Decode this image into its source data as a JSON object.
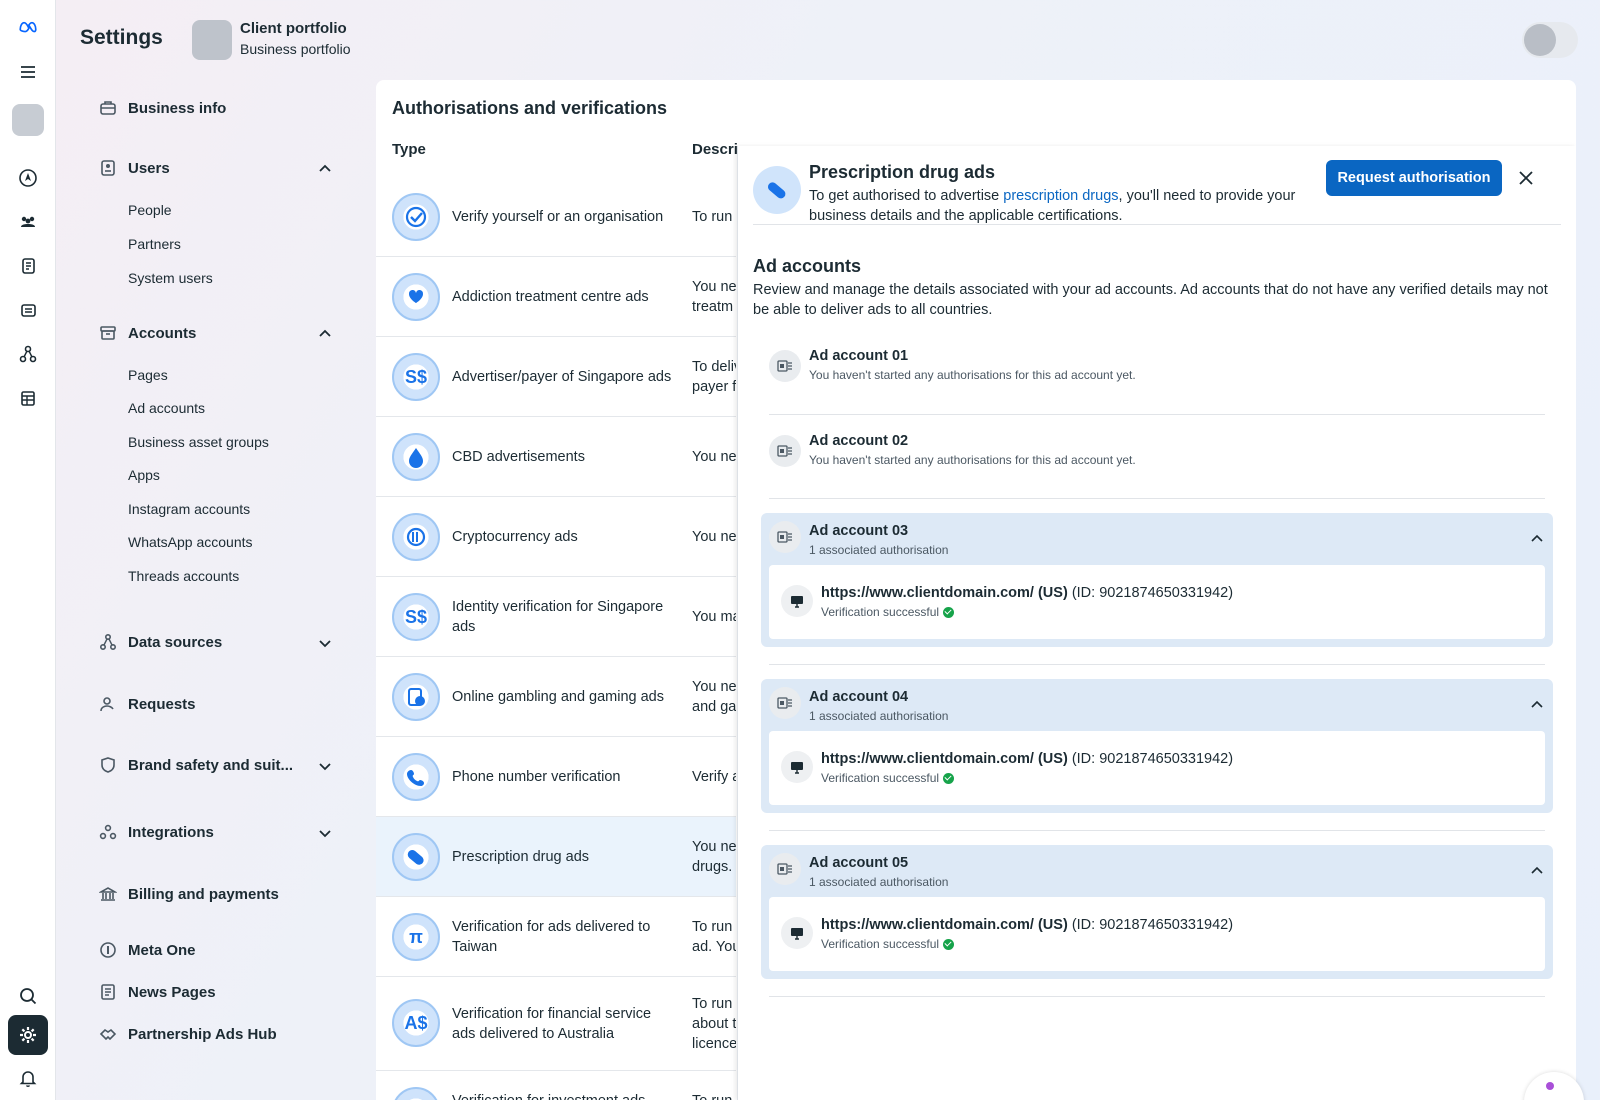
{
  "header": {
    "title": "Settings",
    "portfolio_name": "Client portfolio",
    "portfolio_type": "Business portfolio"
  },
  "rail": {
    "items": [
      "meta-logo-icon",
      "menu-icon",
      "portfolio-square",
      "compass-icon",
      "people-icon",
      "pages-icon",
      "ads-icon",
      "network-icon",
      "table-icon",
      "search-icon",
      "gear-icon",
      "bell-icon"
    ]
  },
  "sidebar": {
    "business_info": "Business info",
    "users": {
      "label": "Users",
      "items": [
        "People",
        "Partners",
        "System users"
      ]
    },
    "accounts": {
      "label": "Accounts",
      "items": [
        "Pages",
        "Ad accounts",
        "Business asset groups",
        "Apps",
        "Instagram accounts",
        "WhatsApp accounts",
        "Threads accounts"
      ]
    },
    "data_sources": "Data sources",
    "requests": "Requests",
    "brand_safety": "Brand safety and suit...",
    "integrations": "Integrations",
    "billing": "Billing and payments",
    "meta_one": "Meta One",
    "news_pages": "News Pages",
    "partnership_ads": "Partnership Ads Hub"
  },
  "main": {
    "title": "Authorisations and verifications",
    "col_type": "Type",
    "col_desc": "Descri",
    "rows": [
      {
        "name": "Verify yourself or an organisation",
        "desc": "To run"
      },
      {
        "name": "Addiction treatment centre ads",
        "desc": "You ne\ntreatm"
      },
      {
        "name": "Advertiser/payer of Singapore ads",
        "desc": "To deliv\npayer f"
      },
      {
        "name": "CBD advertisements",
        "desc": "You ne"
      },
      {
        "name": "Cryptocurrency ads",
        "desc": "You ne"
      },
      {
        "name": "Identity verification for Singapore ads",
        "desc": "You ma"
      },
      {
        "name": "Online gambling and gaming ads",
        "desc": "You ne\nand ga"
      },
      {
        "name": "Phone number verification",
        "desc": "Verify a"
      },
      {
        "name": "Prescription drug ads",
        "desc": "You ne\ndrugs."
      },
      {
        "name": "Verification for ads delivered to Taiwan",
        "desc": "To run\nad. You"
      },
      {
        "name": "Verification for financial service ads delivered to Australia",
        "desc": "To run\nabout t\nlicence"
      },
      {
        "name": "Verification for investment ads",
        "desc": "To run"
      }
    ]
  },
  "panel": {
    "title": "Prescription drug ads",
    "desc_before": "To get authorised to advertise ",
    "desc_link": "prescription drugs",
    "desc_after": ", you'll need to provide your business details and the applicable certifications.",
    "request_button": "Request authorisation",
    "accounts_title": "Ad accounts",
    "accounts_desc": "Review and manage the details associated with your ad accounts. Ad accounts that do not have any verified details may not be able to deliver ads to all countries.",
    "accounts": [
      {
        "name": "Ad account 01",
        "sub": "You haven't started any authorisations for this ad account yet."
      },
      {
        "name": "Ad account 02",
        "sub": "You haven't started any authorisations for this ad account yet."
      },
      {
        "name": "Ad account 03",
        "sub": "1 associated authorisation",
        "url": "https://www.clientdomain.com/ (US)",
        "id": "(ID: 9021874650331942)",
        "status": "Verification successful"
      },
      {
        "name": "Ad account 04",
        "sub": "1 associated authorisation",
        "url": "https://www.clientdomain.com/ (US)",
        "id": "(ID: 9021874650331942)",
        "status": "Verification successful"
      },
      {
        "name": "Ad account 05",
        "sub": "1 associated authorisation",
        "url": "https://www.clientdomain.com/ (US)",
        "id": "(ID: 9021874650331942)",
        "status": "Verification successful"
      }
    ]
  },
  "colors": {
    "accent": "#0a66c2",
    "selected_row": "#eaf3fc",
    "expanded_account": "#dde9f6",
    "success": "#16a34a"
  }
}
